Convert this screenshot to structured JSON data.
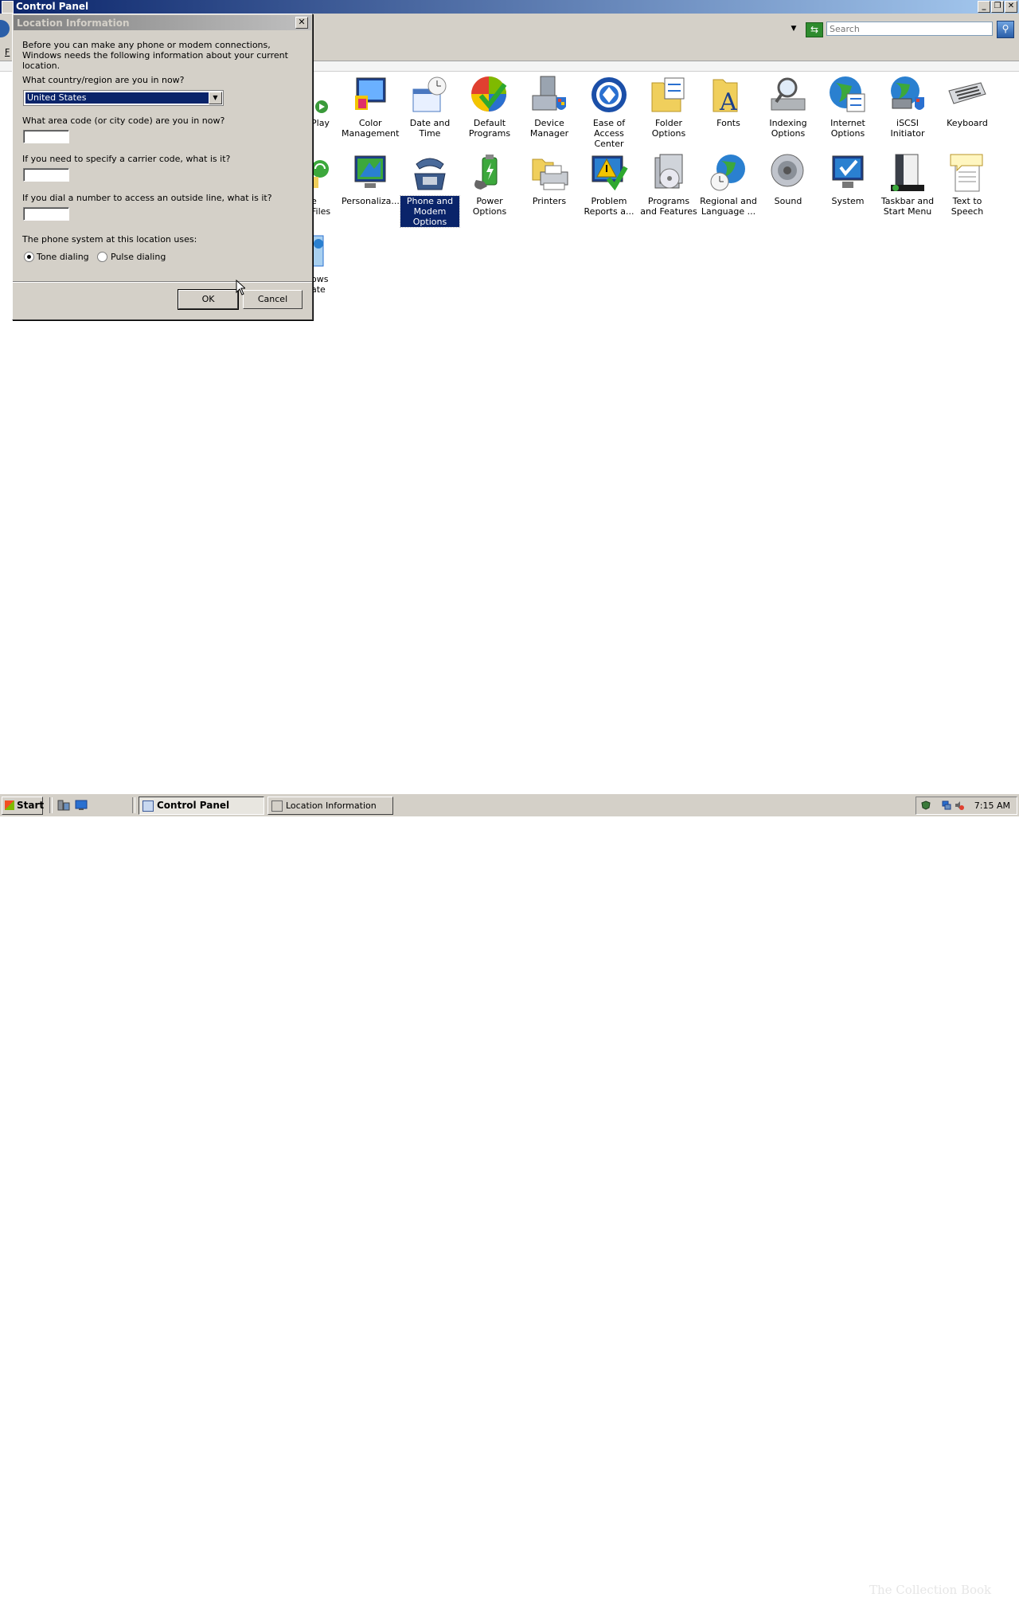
{
  "window": {
    "title": "Control Panel",
    "search_placeholder": "Search",
    "menu_letter": "F"
  },
  "items": [
    {
      "label": "Play"
    },
    {
      "label": "Color Management"
    },
    {
      "label": "Date and Time"
    },
    {
      "label": "Default Programs"
    },
    {
      "label": "Device Manager"
    },
    {
      "label": "Ease of Access Center"
    },
    {
      "label": "Folder Options"
    },
    {
      "label": "Fonts"
    },
    {
      "label": "Indexing Options"
    },
    {
      "label": "Internet Options"
    },
    {
      "label": "iSCSI Initiator"
    },
    {
      "label": "Keyboard"
    },
    {
      "label": "e Files"
    },
    {
      "label": "Personaliza..."
    },
    {
      "label": "Phone and Modem Options",
      "selected": true
    },
    {
      "label": "Power Options"
    },
    {
      "label": "Printers"
    },
    {
      "label": "Problem Reports a..."
    },
    {
      "label": "Programs and Features"
    },
    {
      "label": "Regional and Language ..."
    },
    {
      "label": "Sound"
    },
    {
      "label": "System"
    },
    {
      "label": "Taskbar and Start Menu"
    },
    {
      "label": "Text to Speech"
    },
    {
      "label": "ows ate"
    }
  ],
  "dialog": {
    "title": "Location Information",
    "close_label": "✕",
    "intro": "Before you can make any phone or modem connections, Windows needs the following information about your current location.",
    "country_question": "What country/region are you in now?",
    "country_value": "United States",
    "area_code_question": "What area code (or city code) are you in now?",
    "area_code_value": "",
    "carrier_question": "If you need to specify a carrier code, what is it?",
    "carrier_value": "",
    "outside_line_question": "If you dial a number to access an outside line, what is it?",
    "outside_line_value": "",
    "phone_system_label": "The phone system at this location uses:",
    "tone_label": "Tone dialing",
    "pulse_label": "Pulse dialing",
    "selected_dialing": "tone",
    "ok_label": "OK",
    "cancel_label": "Cancel"
  },
  "taskbar": {
    "start_label": "Start",
    "tasks": [
      {
        "label": "Control Panel",
        "active": true
      },
      {
        "label": "Location Information",
        "active": false
      }
    ],
    "clock": "7:15 AM",
    "watermark": "The Collection Book"
  },
  "colors": {
    "title_active": "#0a246a",
    "dialog_face": "#d4d0c8",
    "selection": "#0a246a"
  }
}
